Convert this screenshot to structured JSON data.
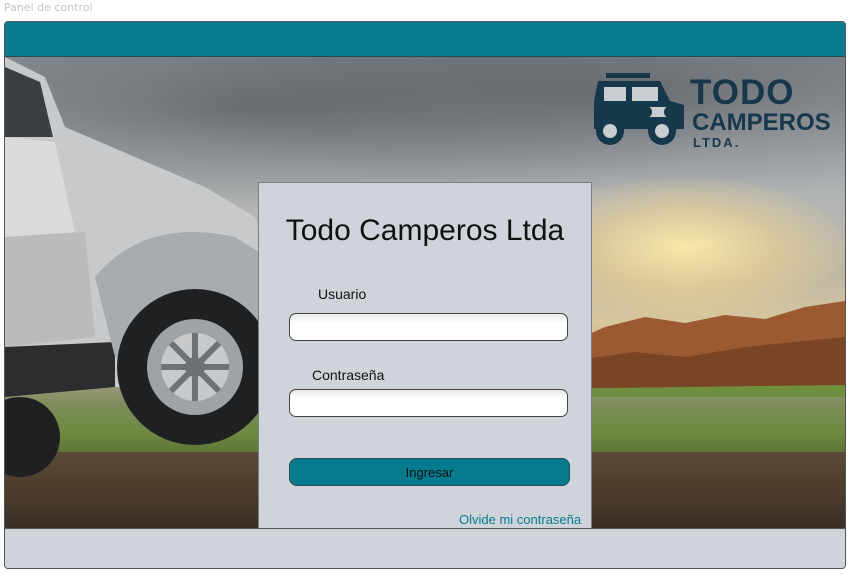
{
  "page": {
    "label": "Panel de control"
  },
  "logo": {
    "line1": "TODO",
    "line2": "CAMPEROS",
    "line3": "LTDA."
  },
  "login": {
    "title": "Todo Camperos Ltda",
    "username_label": "Usuario",
    "username_value": "",
    "password_label": "Contraseña",
    "password_value": "",
    "submit_label": "Ingresar",
    "forgot_label": "Olvide mi contraseña"
  },
  "colors": {
    "accent": "#067b8e",
    "panel": "#ced4da",
    "logo": "#17374a"
  }
}
